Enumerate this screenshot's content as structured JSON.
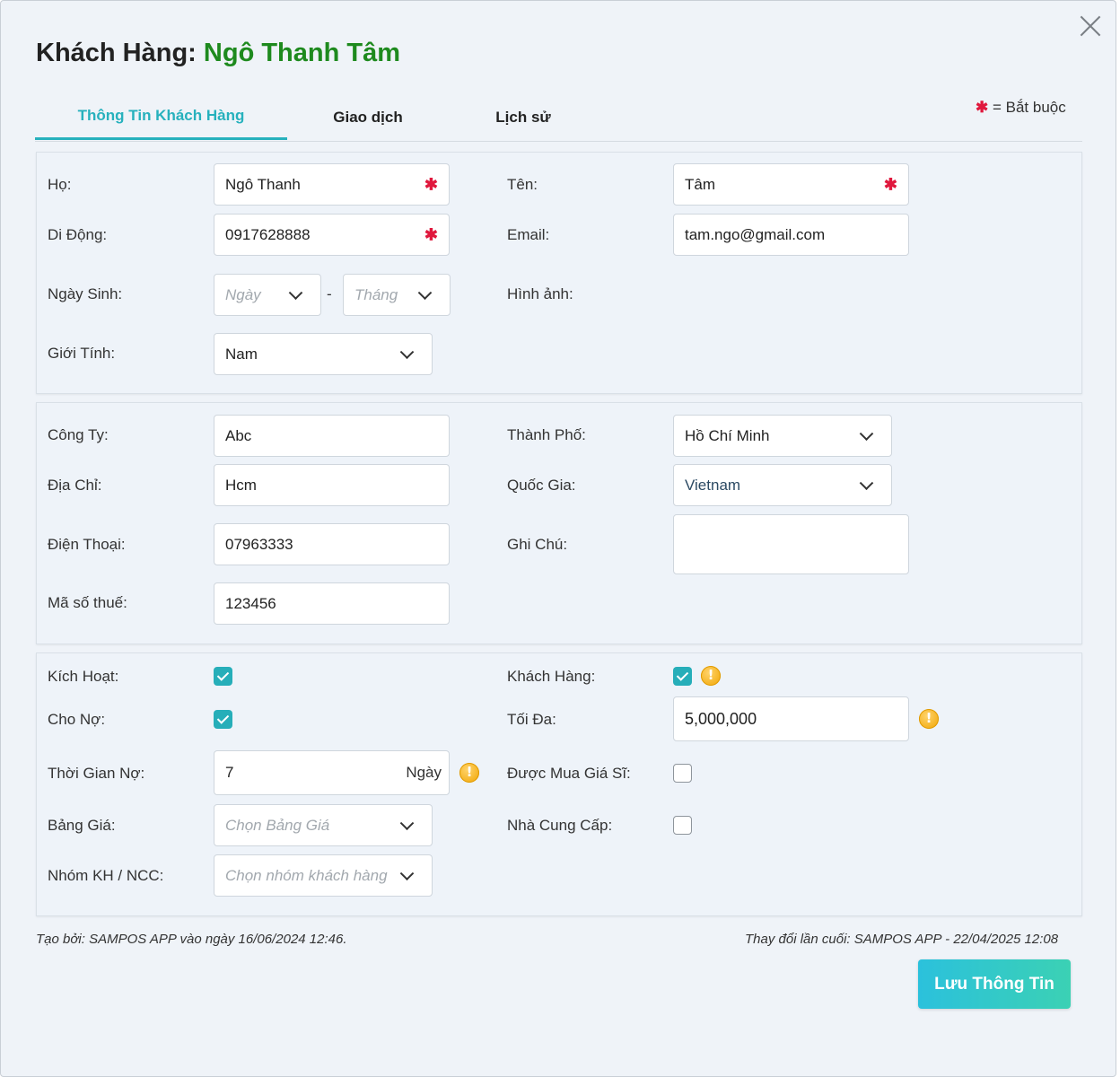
{
  "header": {
    "title_prefix": "Khách Hàng:",
    "customer_name": "Ngô Thanh Tâm",
    "required_note": "= Bắt buộc"
  },
  "tabs": [
    {
      "label": "Thông Tin Khách Hàng",
      "active": true
    },
    {
      "label": "Giao dịch",
      "active": false
    },
    {
      "label": "Lịch sử",
      "active": false
    }
  ],
  "personal": {
    "last_name_label": "Họ:",
    "last_name": "Ngô Thanh",
    "first_name_label": "Tên:",
    "first_name": "Tâm",
    "mobile_label": "Di Động:",
    "mobile": "0917628888",
    "email_label": "Email:",
    "email": "tam.ngo@gmail.com",
    "birthday_label": "Ngày Sinh:",
    "day_placeholder": "Ngày",
    "month_placeholder": "Tháng",
    "separator": "-",
    "image_label": "Hình ảnh:",
    "gender_label": "Giới Tính:",
    "gender": "Nam"
  },
  "company": {
    "company_label": "Công Ty:",
    "company": "Abc",
    "city_label": "Thành Phố:",
    "city": "Hồ Chí Minh",
    "address_label": "Địa Chỉ:",
    "address": "Hcm",
    "country_label": "Quốc Gia:",
    "country": "Vietnam",
    "phone_label": "Điện Thoại:",
    "phone": "07963333",
    "note_label": "Ghi Chú:",
    "note": "",
    "tax_label": "Mã số thuế:",
    "tax": "123456"
  },
  "settings": {
    "active_label": "Kích Hoạt:",
    "active": true,
    "customer_label": "Khách Hàng:",
    "customer": true,
    "debt_label": "Cho Nợ:",
    "debt": true,
    "max_label": "Tối Đa:",
    "max": "5,000,000",
    "debt_time_label": "Thời Gian Nợ:",
    "debt_time": "7",
    "debt_time_unit": "Ngày",
    "wholesale_label": "Được Mua Giá Sĩ:",
    "wholesale": false,
    "price_list_label": "Bảng Giá:",
    "price_list_placeholder": "Chọn Bảng Giá",
    "supplier_label": "Nhà Cung Cấp:",
    "supplier": false,
    "group_label": "Nhóm KH / NCC:",
    "group_placeholder": "Chọn nhóm khách hàng"
  },
  "footer": {
    "created": "Tạo bởi: SAMPOS APP vào ngày 16/06/2024 12:46.",
    "modified": "Thay đổi lần cuối: SAMPOS APP - 22/04/2025 12:08",
    "save_label": "Lưu Thông Tin"
  },
  "colors": {
    "accent": "#27b1bd",
    "name": "#1e8a1e",
    "required": "#e0183d"
  }
}
